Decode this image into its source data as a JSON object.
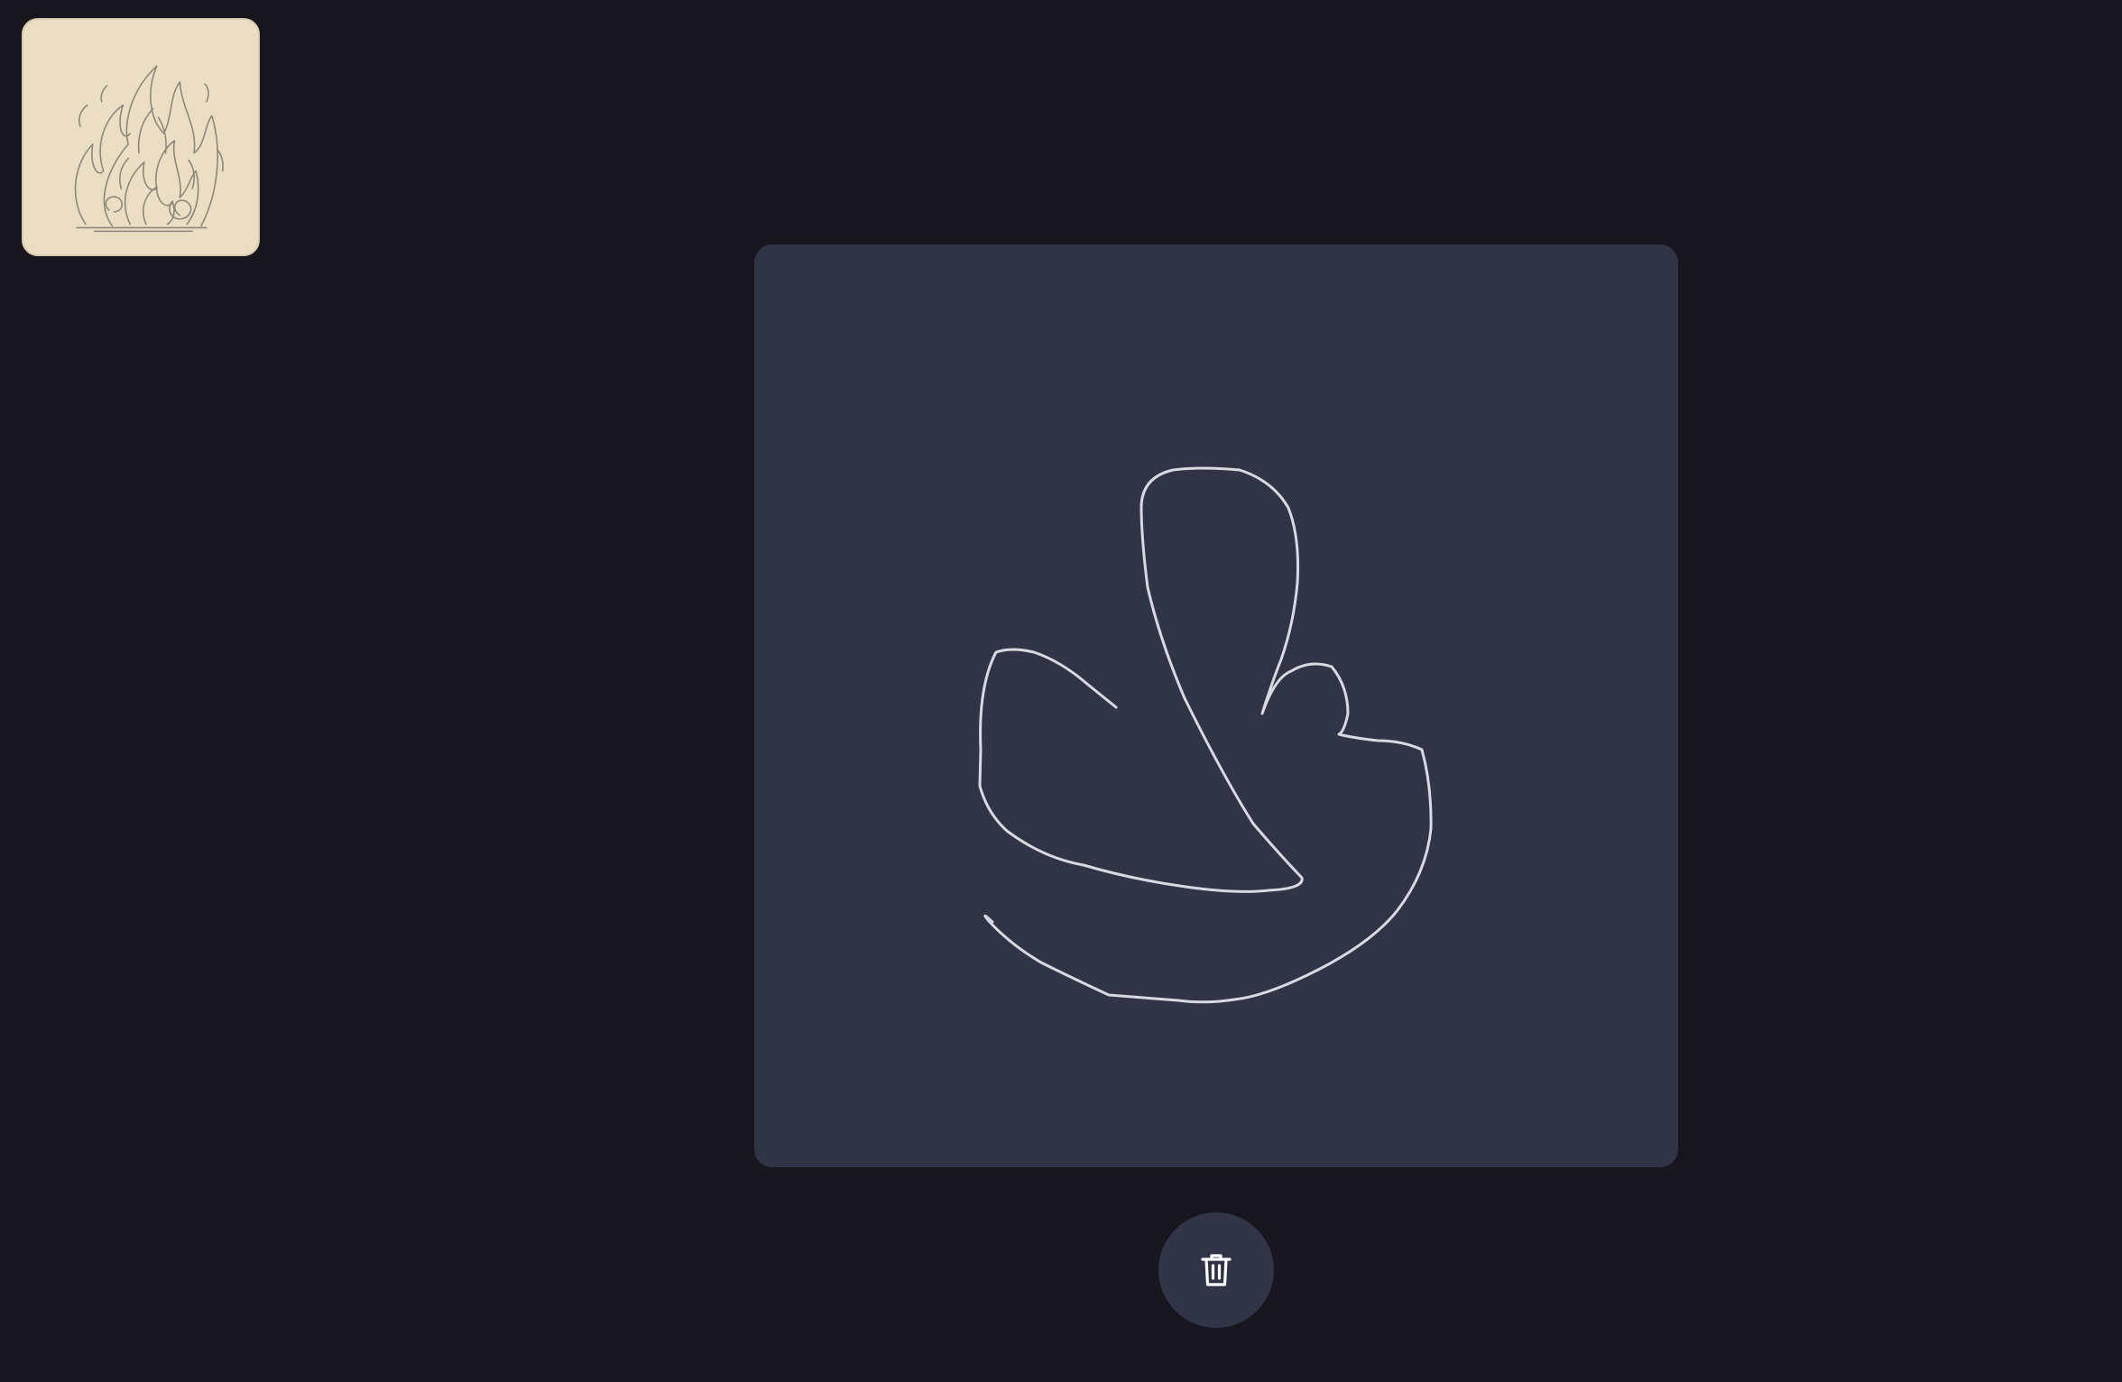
{
  "reference": {
    "image_subject": "flame-drawing",
    "background_color": "#ebdec3"
  },
  "canvas": {
    "background_color": "#313447",
    "stroke_color": "#d9d9e0"
  },
  "toolbar": {
    "clear_button_icon": "trash-icon",
    "clear_button_color": "#313447"
  }
}
